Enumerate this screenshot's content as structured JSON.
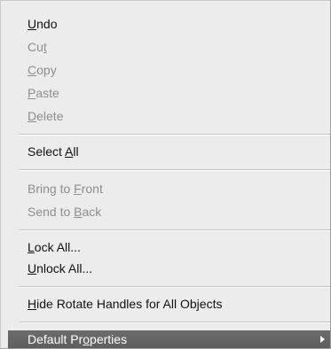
{
  "menu": {
    "items": [
      {
        "pre": "",
        "u": "U",
        "post": "ndo",
        "enabled": true
      },
      {
        "pre": "Cu",
        "u": "t",
        "post": "",
        "enabled": false
      },
      {
        "pre": "",
        "u": "C",
        "post": "opy",
        "enabled": false
      },
      {
        "pre": "",
        "u": "P",
        "post": "aste",
        "enabled": false
      },
      {
        "pre": "",
        "u": "D",
        "post": "elete",
        "enabled": false
      },
      {
        "pre": "Select ",
        "u": "A",
        "post": "ll",
        "enabled": true
      },
      {
        "pre": "Bring to ",
        "u": "F",
        "post": "ront",
        "enabled": false
      },
      {
        "pre": "Send to ",
        "u": "B",
        "post": "ack",
        "enabled": false
      },
      {
        "pre": "",
        "u": "L",
        "post": "ock All...",
        "enabled": true
      },
      {
        "pre": "",
        "u": "U",
        "post": "nlock All...",
        "enabled": true
      },
      {
        "pre": "",
        "u": "H",
        "post": "ide Rotate Handles for All Objects",
        "enabled": true
      },
      {
        "pre": "Default Pr",
        "u": "o",
        "post": "perties",
        "enabled": true,
        "highlighted": true,
        "submenu": true
      }
    ]
  }
}
